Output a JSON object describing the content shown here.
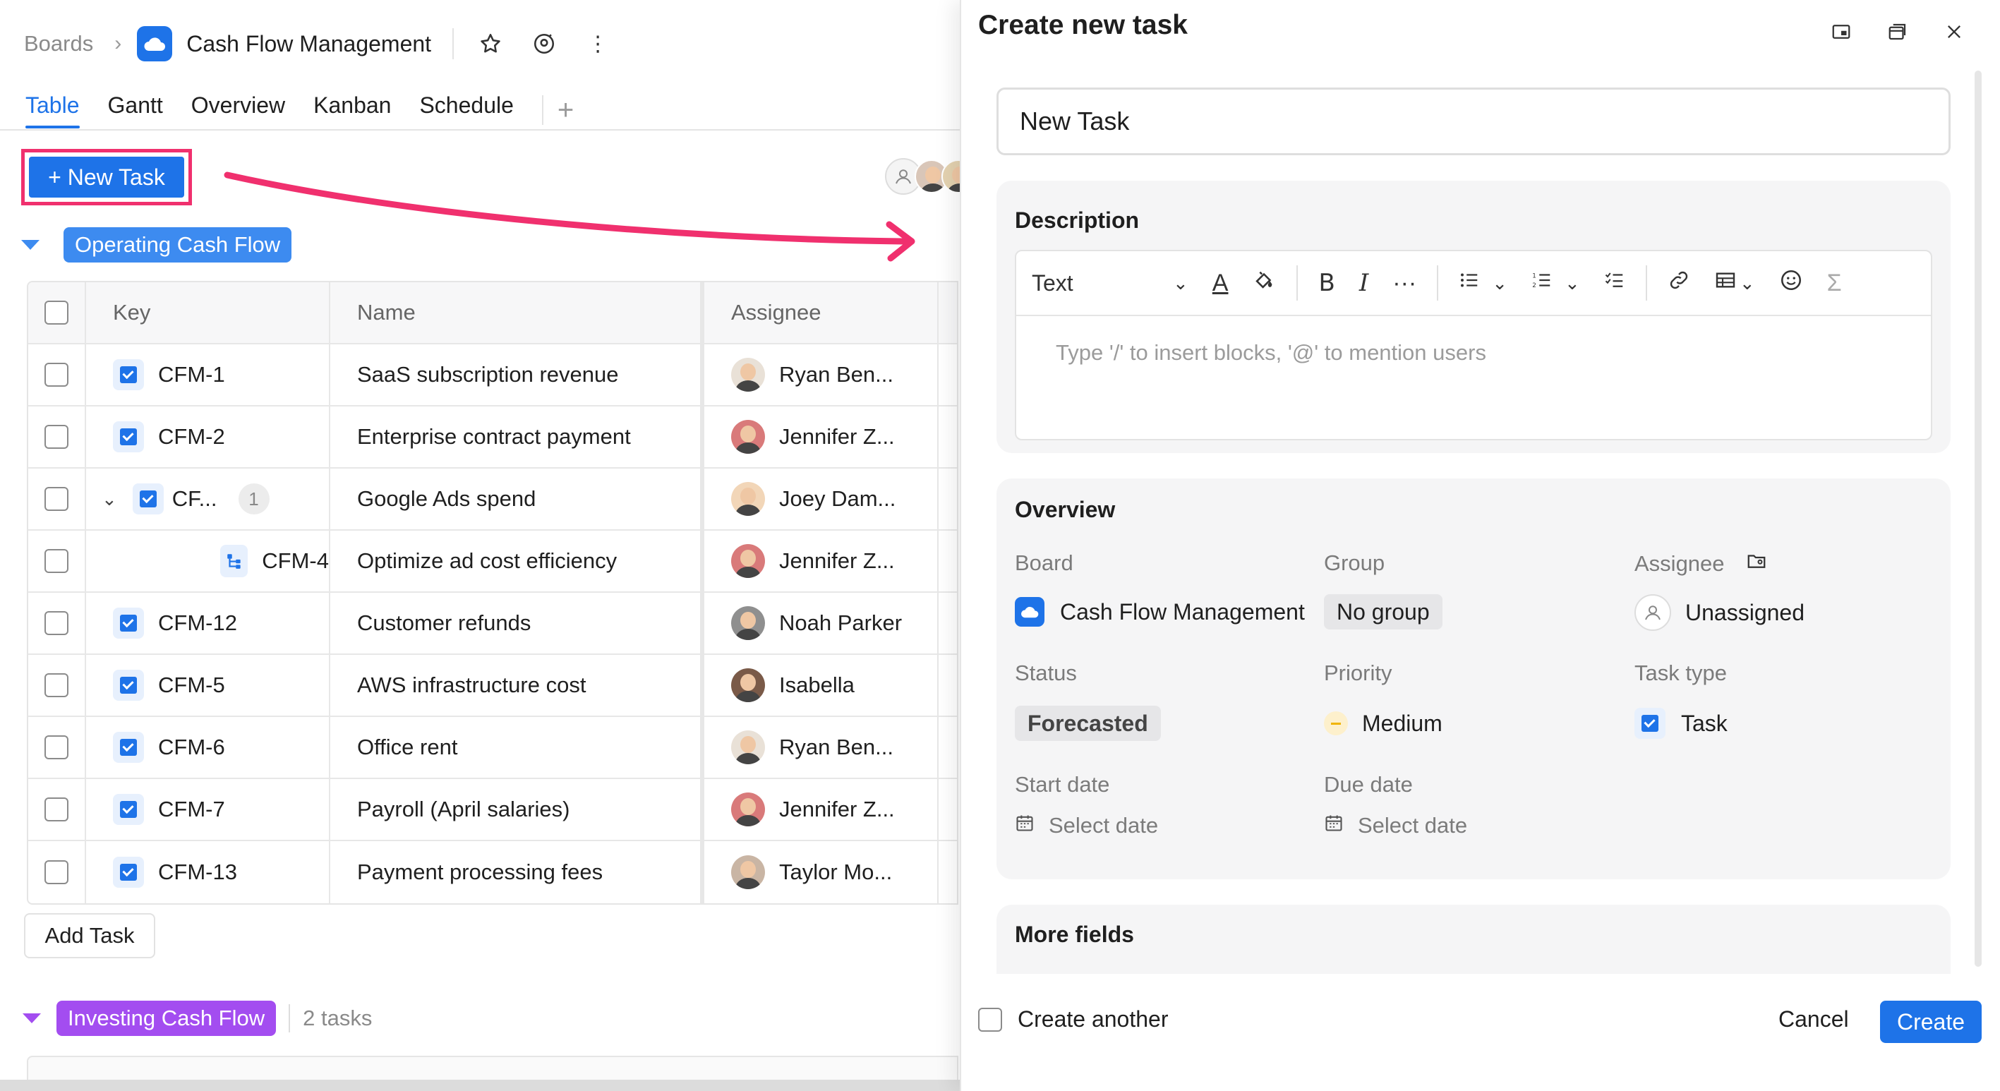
{
  "breadcrumb": {
    "root": "Boards",
    "separator": ">",
    "board": "Cash Flow Management"
  },
  "tabs": [
    {
      "label": "Table"
    },
    {
      "label": "Gantt"
    },
    {
      "label": "Overview"
    },
    {
      "label": "Kanban"
    },
    {
      "label": "Schedule"
    }
  ],
  "toolbar": {
    "new_task_label": "+ New Task"
  },
  "group1": {
    "label": "Operating Cash Flow"
  },
  "table": {
    "headers": {
      "key": "Key",
      "name": "Name",
      "assignee": "Assignee"
    },
    "rows": [
      {
        "key": "CFM-1",
        "name": "SaaS subscription revenue",
        "assignee": "Ryan Ben..."
      },
      {
        "key": "CFM-2",
        "name": "Enterprise contract payment",
        "assignee": "Jennifer Z..."
      },
      {
        "key": "CF...",
        "name": "Google Ads spend",
        "assignee": "Joey Dam...",
        "subtasks": "1"
      },
      {
        "key": "CFM-4",
        "name": "Optimize ad cost efficiency",
        "assignee": "Jennifer Z..."
      },
      {
        "key": "CFM-12",
        "name": "Customer refunds",
        "assignee": "Noah Parker"
      },
      {
        "key": "CFM-5",
        "name": "AWS infrastructure cost",
        "assignee": "Isabella"
      },
      {
        "key": "CFM-6",
        "name": "Office rent",
        "assignee": "Ryan Ben..."
      },
      {
        "key": "CFM-7",
        "name": "Payroll (April salaries)",
        "assignee": "Jennifer Z..."
      },
      {
        "key": "CFM-13",
        "name": "Payment processing fees",
        "assignee": "Taylor Mo..."
      }
    ]
  },
  "add_task_label": "Add Task",
  "group2": {
    "label": "Investing Cash Flow",
    "count": "2 tasks"
  },
  "panel": {
    "title": "Create new task",
    "name_value": "New Task",
    "description": {
      "title": "Description",
      "text_style": "Text",
      "placeholder": "Type '/' to insert blocks, '@' to mention users"
    },
    "overview": {
      "title": "Overview",
      "board_label": "Board",
      "board_value": "Cash Flow Management",
      "group_label": "Group",
      "group_value": "No group",
      "assignee_label": "Assignee",
      "assignee_value": "Unassigned",
      "status_label": "Status",
      "status_value": "Forecasted",
      "priority_label": "Priority",
      "priority_value": "Medium",
      "tasktype_label": "Task type",
      "tasktype_value": "Task",
      "start_label": "Start date",
      "start_value": "Select date",
      "due_label": "Due date",
      "due_value": "Select date"
    },
    "more_fields": "More fields",
    "create_another": "Create another",
    "cancel": "Cancel",
    "create": "Create"
  },
  "colors": {
    "accent": "#1e73e8",
    "highlight": "#f0306e",
    "group1": "#3d8bf0",
    "group2": "#a34df0"
  }
}
